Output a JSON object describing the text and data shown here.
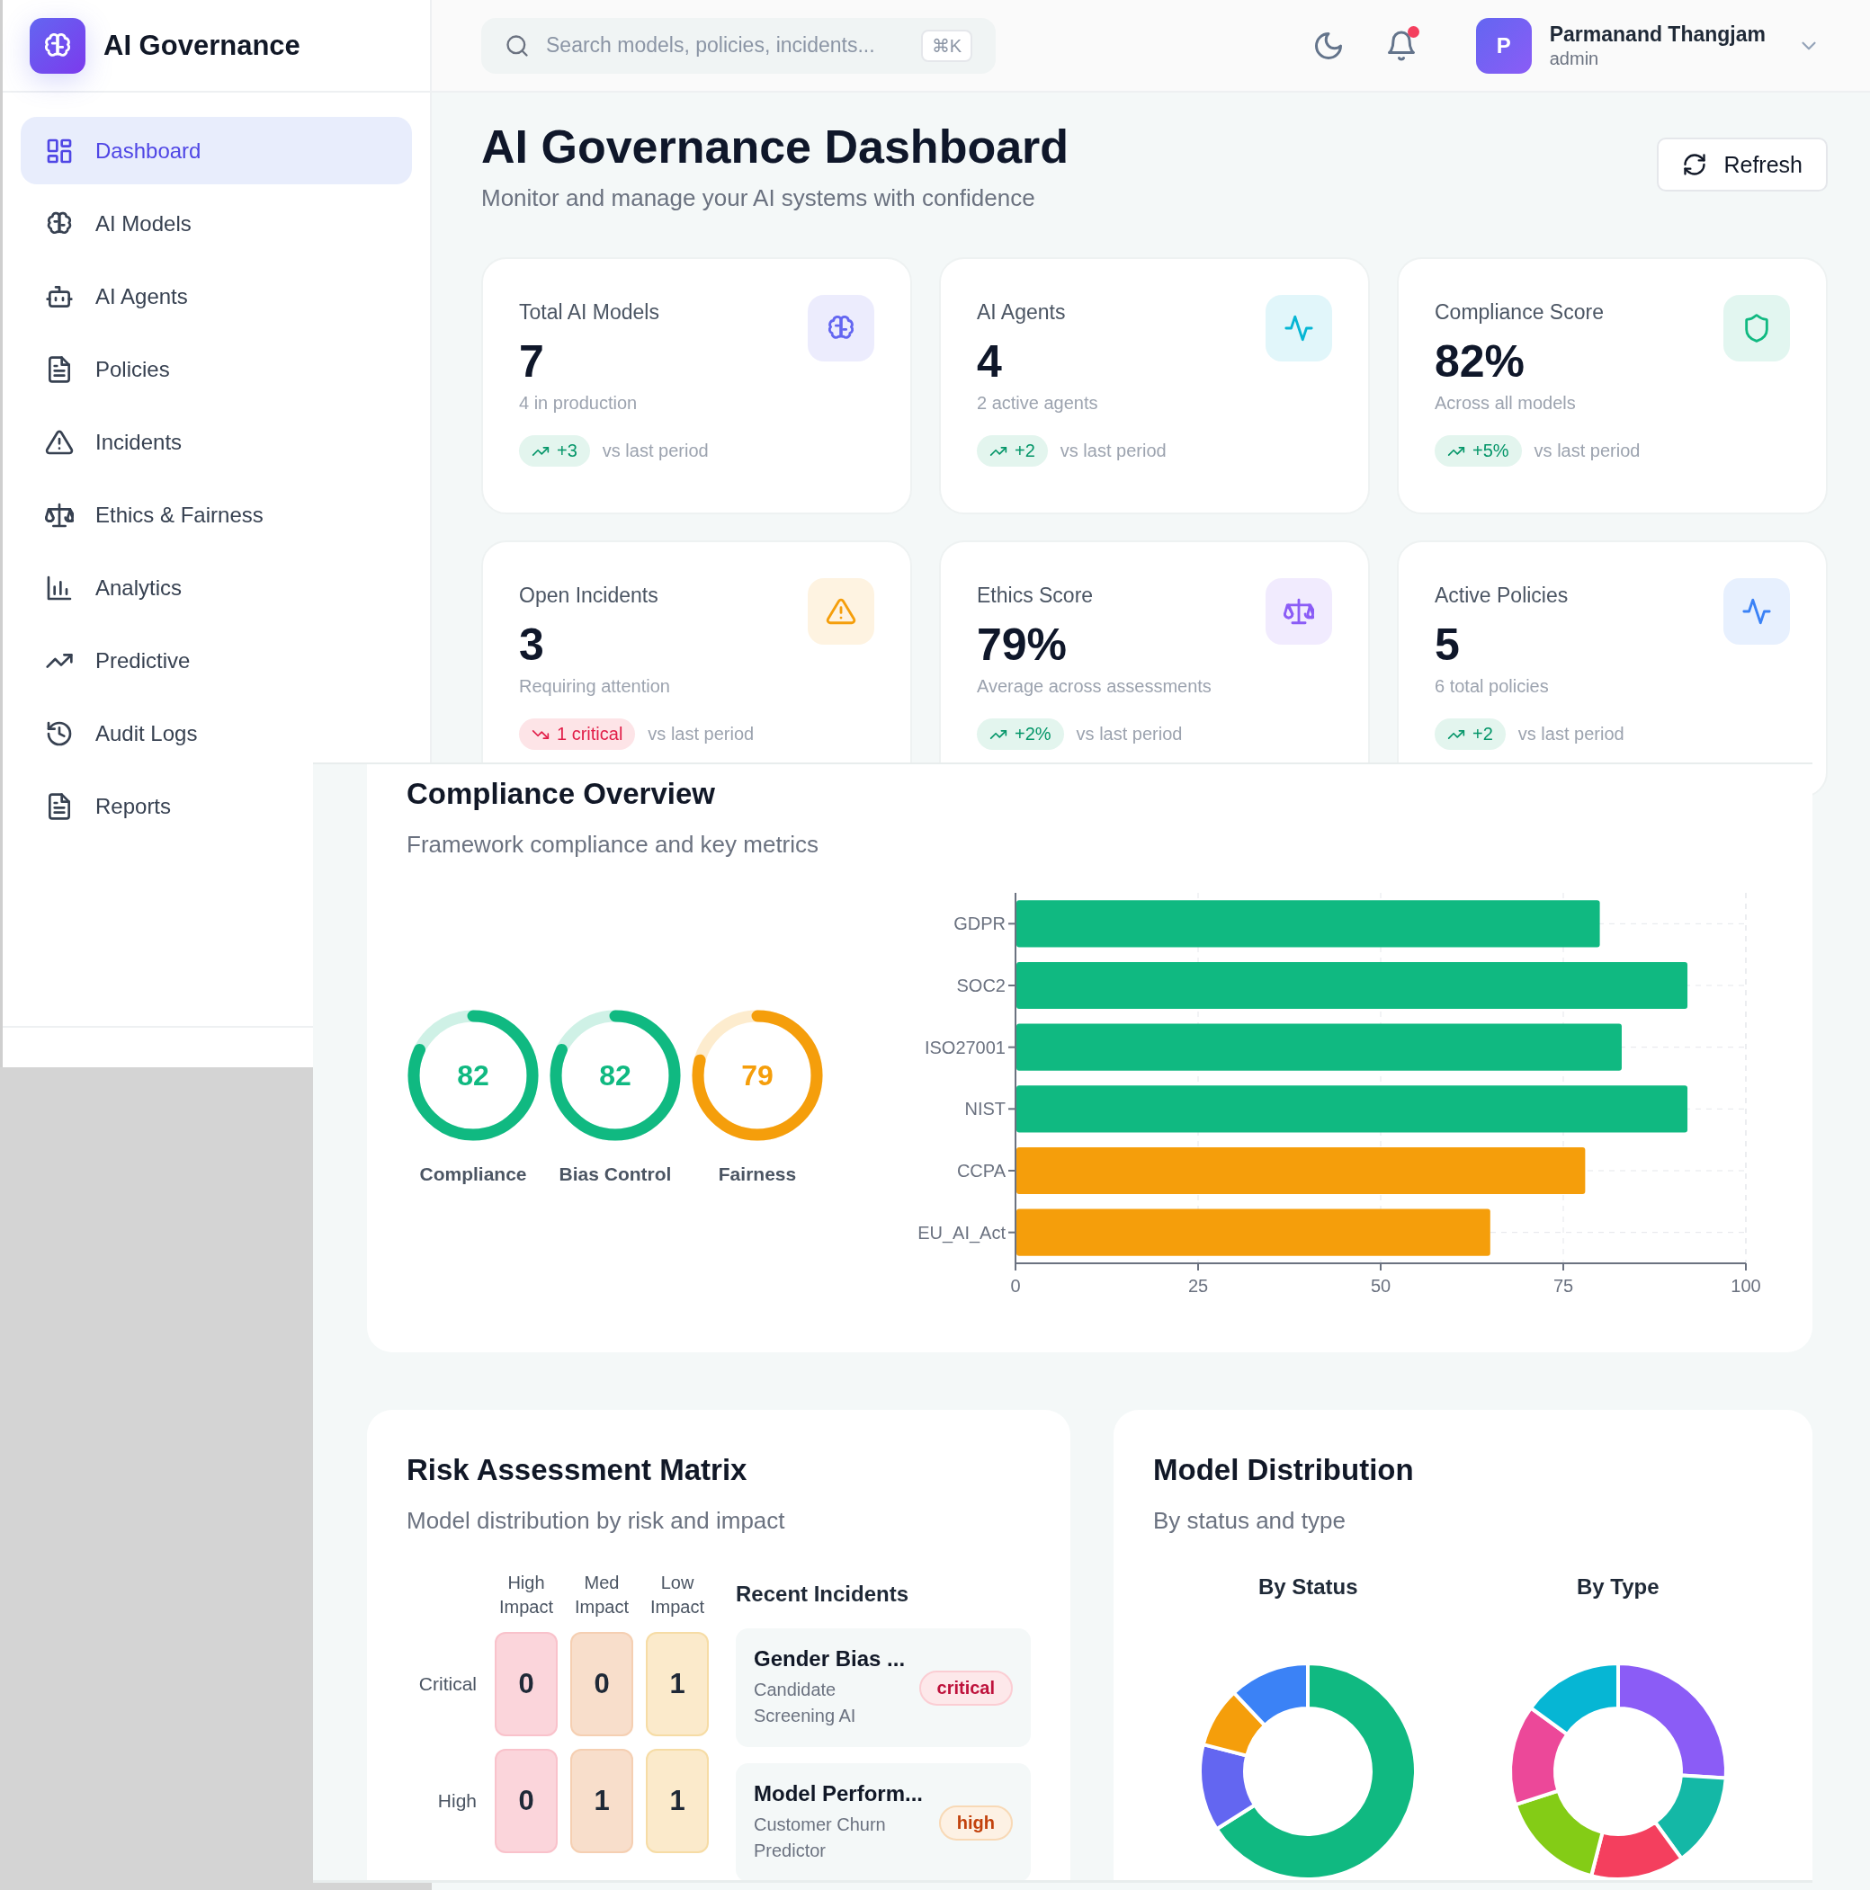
{
  "sidebar": {
    "brand": "AI Governance",
    "items": [
      {
        "label": "Dashboard",
        "selected": true
      },
      {
        "label": "AI Models",
        "selected": false
      },
      {
        "label": "AI Agents",
        "selected": false
      },
      {
        "label": "Policies",
        "selected": false
      },
      {
        "label": "Incidents",
        "selected": false
      },
      {
        "label": "Ethics & Fairness",
        "selected": false
      },
      {
        "label": "Analytics",
        "selected": false
      },
      {
        "label": "Predictive",
        "selected": false
      },
      {
        "label": "Audit Logs",
        "selected": false
      },
      {
        "label": "Reports",
        "selected": false
      }
    ]
  },
  "header": {
    "search": {
      "placeholder": "Search models, policies, incidents...",
      "shortcut": "⌘K"
    },
    "notifications": {
      "unread": true
    },
    "user": {
      "initial": "P",
      "name": "Parmanand Thangjam",
      "role": "admin"
    }
  },
  "page": {
    "title": "AI Governance Dashboard",
    "subtitle": "Monitor and manage your AI systems with confidence",
    "refresh": "Refresh"
  },
  "stats": [
    {
      "label": "Total AI Models",
      "value": "7",
      "note": "4 in production",
      "color": "#6366f1",
      "kind": "up",
      "change": "+3",
      "period": "vs last period"
    },
    {
      "label": "AI Agents",
      "value": "4",
      "note": "2 active agents",
      "color": "#06b6d4",
      "kind": "up",
      "change": "+2",
      "period": "vs last period"
    },
    {
      "label": "Compliance Score",
      "value": "82%",
      "note": "Across all models",
      "color": "#10b981",
      "kind": "up",
      "change": "+5%",
      "period": "vs last period"
    },
    {
      "label": "Open Incidents",
      "value": "3",
      "note": "Requiring attention",
      "color": "#f59e0b",
      "kind": "down",
      "change": "1 critical",
      "period": "vs last period"
    },
    {
      "label": "Ethics Score",
      "value": "79%",
      "note": "Average across assessments",
      "color": "#8b5cf6",
      "kind": "up",
      "change": "+2%",
      "period": "vs last period"
    },
    {
      "label": "Active Policies",
      "value": "5",
      "note": "6 total policies",
      "color": "#3b82f6",
      "kind": "up",
      "change": "+2",
      "period": "vs last period"
    }
  ],
  "compliance": {
    "title": "Compliance Overview",
    "subtitle": "Framework compliance and key metrics",
    "gauges": [
      {
        "label": "Compliance",
        "value": "82",
        "level": 0.82,
        "color": "#10b981"
      },
      {
        "label": "Bias Control",
        "value": "82",
        "level": 0.82,
        "color": "#10b981"
      },
      {
        "label": "Fairness",
        "value": "79",
        "level": 0.79,
        "color": "#f59e0b"
      }
    ],
    "chart_data": {
      "type": "bar",
      "orientation": "horizontal",
      "grid": true,
      "categories": [
        "GDPR",
        "SOC2",
        "ISO27001",
        "NIST",
        "CCPA",
        "EU_AI_Act"
      ],
      "series": [
        {
          "color": "#10b981",
          "values": [
            80,
            92,
            83,
            92,
            null,
            null
          ]
        },
        {
          "color": "#f59e0b",
          "values": [
            null,
            null,
            null,
            null,
            78,
            65
          ]
        }
      ],
      "xlim": [
        0,
        100
      ],
      "xticks": [
        {
          "value": 0,
          "label": "0"
        },
        {
          "value": 25,
          "label": "25"
        },
        {
          "value": 50,
          "label": "50"
        },
        {
          "value": 75,
          "label": "75"
        },
        {
          "value": 100,
          "label": "100"
        }
      ]
    }
  },
  "risk": {
    "title": "Risk Assessment Matrix",
    "subtitle": "Model distribution by risk and impact",
    "impact_levels": [
      "High Impact",
      "Med Impact",
      "Low Impact"
    ],
    "risk_levels": [
      {
        "label": "Critical",
        "counts": [
          "0",
          "0",
          "1"
        ]
      },
      {
        "label": "High",
        "counts": [
          "0",
          "1",
          "1"
        ]
      }
    ],
    "incidents_title": "Recent Incidents",
    "incidents": [
      {
        "title": "Gender Bias ...",
        "model": "Candidate Screening AI",
        "severity": "critical"
      },
      {
        "title": "Model Perform...",
        "model": "Customer Churn Predictor",
        "severity": "high"
      }
    ]
  },
  "distribution": {
    "title": "Model Distribution",
    "subtitle": "By status and type",
    "charts": [
      {
        "title": "By Status"
      },
      {
        "title": "By Type"
      }
    ]
  }
}
